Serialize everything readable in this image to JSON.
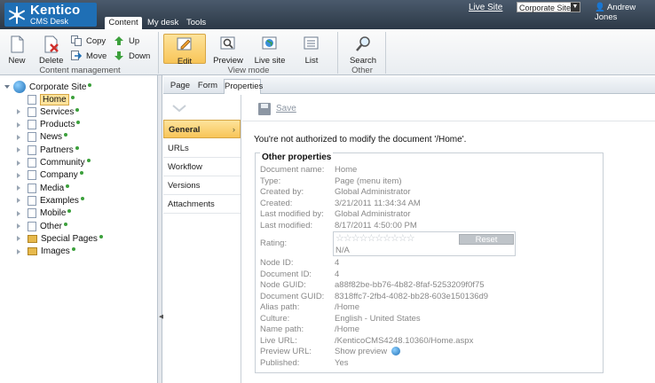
{
  "header": {
    "brand_name": "Kentico",
    "brand_sub": "CMS Desk",
    "tabs": [
      "Content",
      "My desk",
      "Tools"
    ],
    "live_site_link": "Live Site",
    "site_select": "Corporate Site",
    "user": "Andrew Jones"
  },
  "ribbon": {
    "content_management": {
      "label": "Content management",
      "new": "New",
      "delete": "Delete",
      "copy": "Copy",
      "move": "Move",
      "up": "Up",
      "down": "Down"
    },
    "view_mode": {
      "label": "View mode",
      "edit": "Edit",
      "preview": "Preview",
      "live_site": "Live site",
      "list": "List"
    },
    "other": {
      "label": "Other",
      "search": "Search"
    }
  },
  "tree": {
    "root": "Corporate Site",
    "items": [
      "Home",
      "Services",
      "Products",
      "News",
      "Partners",
      "Community",
      "Company",
      "Media",
      "Examples",
      "Mobile",
      "Other",
      "Special Pages",
      "Images"
    ]
  },
  "subtabs": [
    "Page",
    "Form",
    "Properties"
  ],
  "vnav": [
    "General",
    "URLs",
    "Workflow",
    "Versions",
    "Attachments"
  ],
  "main": {
    "save_label": "Save",
    "message": "You're not authorized to modify the document '/Home'.",
    "other_properties": {
      "title": "Other properties",
      "document_name_label": "Document name:",
      "document_name": "Home",
      "type_label": "Type:",
      "type": "Page (menu item)",
      "created_by_label": "Created by:",
      "created_by": "Global Administrator",
      "created_label": "Created:",
      "created": "3/21/2011 11:34:34 AM",
      "last_modified_by_label": "Last modified by:",
      "last_modified_by": "Global Administrator",
      "last_modified_label": "Last modified:",
      "last_modified": "8/17/2011 4:50:00 PM",
      "rating_label": "Rating:",
      "rating_stars": "☆☆☆☆☆☆☆☆☆☆",
      "rating_value": "N/A",
      "reset_label": "Reset",
      "node_id_label": "Node ID:",
      "node_id": "4",
      "document_id_label": "Document ID:",
      "document_id": "4",
      "node_guid_label": "Node GUID:",
      "node_guid": "a88f82be-bb76-4b82-8faf-5253209f0f75",
      "document_guid_label": "Document GUID:",
      "document_guid": "8318ffc7-2fb4-4082-bb28-603e150136d9",
      "alias_path_label": "Alias path:",
      "alias_path": "/Home",
      "culture_label": "Culture:",
      "culture": "English - United States",
      "name_path_label": "Name path:",
      "name_path": "/Home",
      "live_url_label": "Live URL:",
      "live_url": "/KenticoCMS4248.10360/Home.aspx",
      "preview_url_label": "Preview URL:",
      "preview_url": "Show preview",
      "published_label": "Published:",
      "published": "Yes"
    }
  },
  "colors": {
    "header_bg": "#3a4756",
    "brand_blue": "#1f6fb5",
    "selected_bg": "#f8c558",
    "status_green": "#3ca03c"
  }
}
